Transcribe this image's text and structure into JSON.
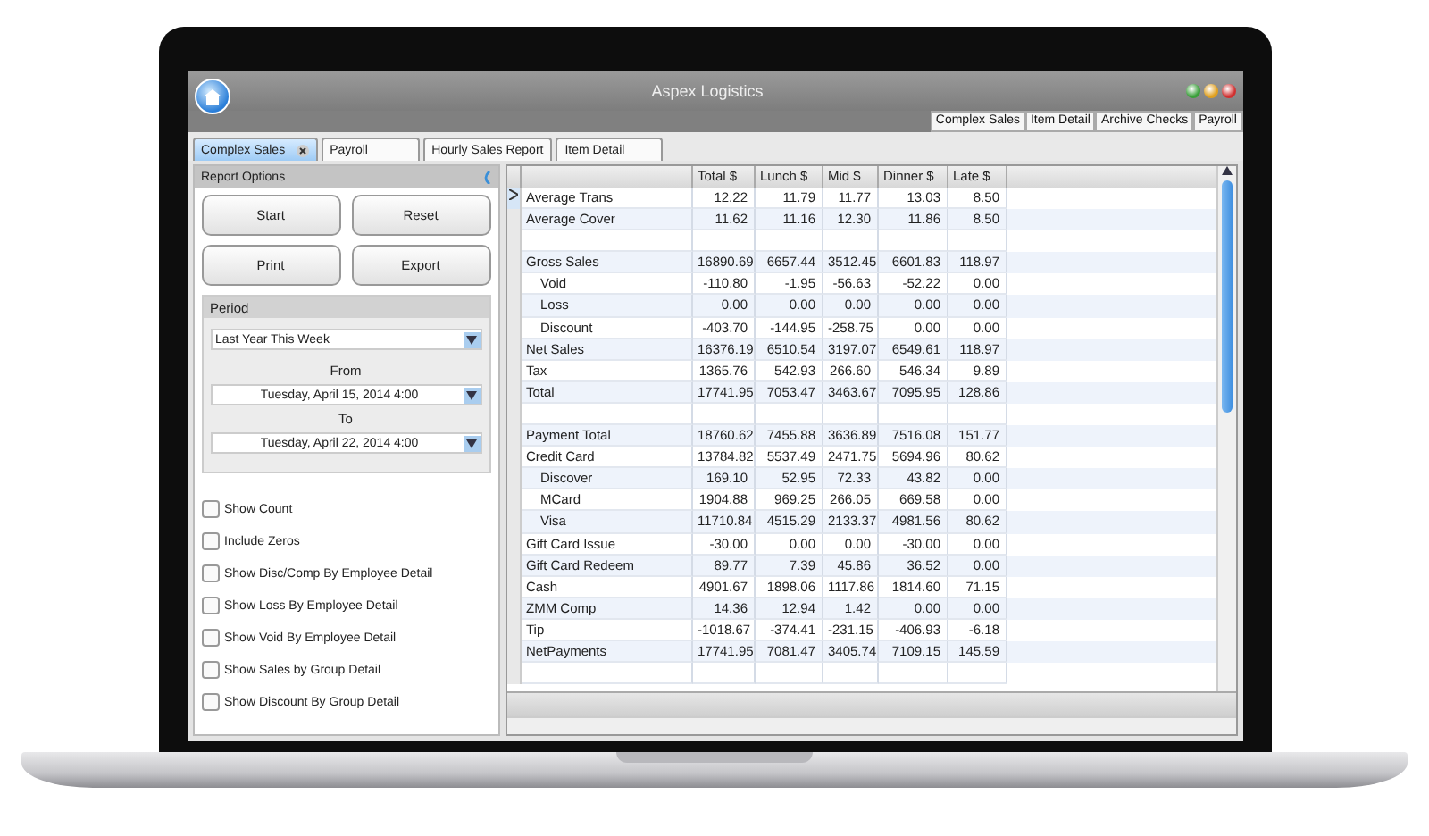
{
  "window": {
    "title": "Aspex Logistics"
  },
  "top_tabs": [
    {
      "label": "Complex Sales"
    },
    {
      "label": "Item Detail"
    },
    {
      "label": "Archive Checks"
    },
    {
      "label": "Payroll"
    }
  ],
  "doc_tabs": [
    {
      "label": "Complex Sales",
      "selected": true,
      "closable": true
    },
    {
      "label": "Payroll",
      "selected": false,
      "closable": false
    },
    {
      "label": "Hourly Sales Report",
      "selected": false,
      "closable": false
    },
    {
      "label": "Item Detail",
      "selected": false,
      "closable": false
    }
  ],
  "report_options": {
    "title": "Report Options",
    "buttons": [
      "Start",
      "Reset",
      "Print",
      "Export"
    ],
    "period": {
      "title": "Period",
      "preset": "Last Year This Week",
      "from_label": "From",
      "from": "Tuesday, April 15, 2014 4:00",
      "to_label": "To",
      "to": "Tuesday, April 22, 2014 4:00"
    },
    "options": [
      {
        "label": "Show Count",
        "checked": false
      },
      {
        "label": "Include Zeros",
        "checked": false
      },
      {
        "label": "Show Disc/Comp By Employee Detail",
        "checked": false
      },
      {
        "label": "Show Loss By Employee Detail",
        "checked": false
      },
      {
        "label": "Show Void By Employee Detail",
        "checked": false
      },
      {
        "label": "Show Sales by Group Detail",
        "checked": false
      },
      {
        "label": "Show Discount By Group Detail",
        "checked": false
      }
    ]
  },
  "table": {
    "columns": [
      "Total $",
      "Lunch $",
      "Mid $",
      "Dinner $",
      "Late $"
    ],
    "rows": [
      {
        "kind": "data",
        "label": "Average Trans",
        "values": [
          "12.22",
          "11.79",
          "11.77",
          "13.03",
          "8.50"
        ],
        "selected": true
      },
      {
        "kind": "data",
        "label": "Average Cover",
        "values": [
          "11.62",
          "11.16",
          "12.30",
          "11.86",
          "8.50"
        ],
        "selected": false
      },
      {
        "kind": "spacer"
      },
      {
        "kind": "data",
        "label": "Gross Sales",
        "values": [
          "16890.69",
          "6657.44",
          "3512.45",
          "6601.83",
          "118.97"
        ],
        "selected": false,
        "children": [
          {
            "kind": "data",
            "label": "Void",
            "values": [
              "-110.80",
              "-1.95",
              "-56.63",
              "-52.22",
              "0.00"
            ],
            "selected": false
          },
          {
            "kind": "data",
            "label": "Loss",
            "values": [
              "0.00",
              "0.00",
              "0.00",
              "0.00",
              "0.00"
            ],
            "selected": false
          },
          {
            "kind": "data",
            "label": "Discount",
            "values": [
              "-403.70",
              "-144.95",
              "-258.75",
              "0.00",
              "0.00"
            ],
            "selected": false
          }
        ]
      },
      {
        "kind": "data",
        "label": "Net Sales",
        "values": [
          "16376.19",
          "6510.54",
          "3197.07",
          "6549.61",
          "118.97"
        ],
        "selected": false
      },
      {
        "kind": "data",
        "label": "Tax",
        "values": [
          "1365.76",
          "542.93",
          "266.60",
          "546.34",
          "9.89"
        ],
        "selected": false
      },
      {
        "kind": "data",
        "label": "Total",
        "values": [
          "17741.95",
          "7053.47",
          "3463.67",
          "7095.95",
          "128.86"
        ],
        "selected": false
      },
      {
        "kind": "spacer"
      },
      {
        "kind": "data",
        "label": "Payment Total",
        "values": [
          "18760.62",
          "7455.88",
          "3636.89",
          "7516.08",
          "151.77"
        ],
        "selected": false
      },
      {
        "kind": "data",
        "label": "Credit Card",
        "values": [
          "13784.82",
          "5537.49",
          "2471.75",
          "5694.96",
          "80.62"
        ],
        "selected": false,
        "children": [
          {
            "kind": "data",
            "label": "Discover",
            "values": [
              "169.10",
              "52.95",
              "72.33",
              "43.82",
              "0.00"
            ],
            "selected": false
          },
          {
            "kind": "data",
            "label": "MCard",
            "values": [
              "1904.88",
              "969.25",
              "266.05",
              "669.58",
              "0.00"
            ],
            "selected": false
          },
          {
            "kind": "data",
            "label": "Visa",
            "values": [
              "11710.84",
              "4515.29",
              "2133.37",
              "4981.56",
              "80.62"
            ],
            "selected": false
          }
        ]
      },
      {
        "kind": "data",
        "label": "Gift Card Issue",
        "values": [
          "-30.00",
          "0.00",
          "0.00",
          "-30.00",
          "0.00"
        ],
        "selected": false
      },
      {
        "kind": "data",
        "label": "Gift Card Redeem",
        "values": [
          "89.77",
          "7.39",
          "45.86",
          "36.52",
          "0.00"
        ],
        "selected": false
      },
      {
        "kind": "data",
        "label": "Cash",
        "values": [
          "4901.67",
          "1898.06",
          "1117.86",
          "1814.60",
          "71.15"
        ],
        "selected": false
      },
      {
        "kind": "data",
        "label": "ZMM Comp",
        "values": [
          "14.36",
          "12.94",
          "1.42",
          "0.00",
          "0.00"
        ],
        "selected": false
      },
      {
        "kind": "data",
        "label": "Tip",
        "values": [
          "-1018.67",
          "-374.41",
          "-231.15",
          "-406.93",
          "-6.18"
        ],
        "selected": false
      },
      {
        "kind": "data",
        "label": "NetPayments",
        "values": [
          "17741.95",
          "7081.47",
          "3405.74",
          "7109.15",
          "145.59"
        ],
        "selected": false
      },
      {
        "kind": "spacer"
      }
    ]
  }
}
